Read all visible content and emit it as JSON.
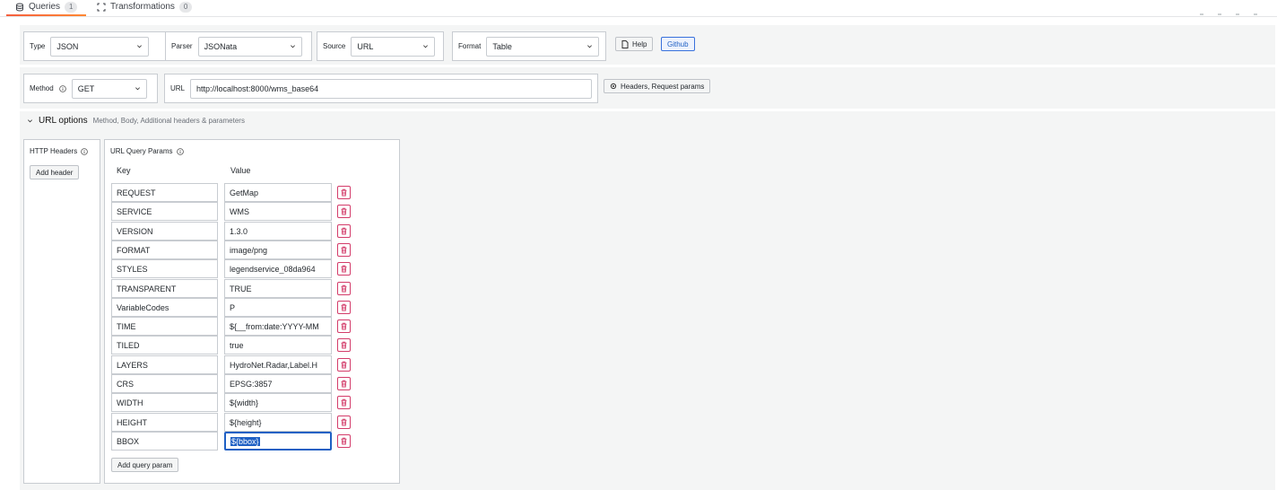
{
  "tabs": [
    {
      "label": "Queries",
      "count": "1",
      "icon": "database-icon"
    },
    {
      "label": "Transformations",
      "count": "0",
      "icon": "transform-icon"
    }
  ],
  "controls": {
    "type": {
      "label": "Type",
      "value": "JSON"
    },
    "parser": {
      "label": "Parser",
      "value": "JSONata"
    },
    "source": {
      "label": "Source",
      "value": "URL"
    },
    "format": {
      "label": "Format",
      "value": "Table"
    },
    "help_label": "Help",
    "github_label": "Github"
  },
  "request": {
    "method_label": "Method",
    "method_value": "GET",
    "url_label": "URL",
    "url_value": "http://localhost:8000/wms_base64",
    "headers_button": "Headers, Request params"
  },
  "url_options": {
    "title": "URL options",
    "description": "Method, Body, Additional headers & parameters"
  },
  "http_headers": {
    "title": "HTTP Headers",
    "add_label": "Add header"
  },
  "query_params": {
    "title": "URL Query Params",
    "key_header": "Key",
    "value_header": "Value",
    "add_label": "Add query param",
    "rows": [
      {
        "key": "REQUEST",
        "value": "GetMap"
      },
      {
        "key": "SERVICE",
        "value": "WMS"
      },
      {
        "key": "VERSION",
        "value": "1.3.0"
      },
      {
        "key": "FORMAT",
        "value": "image/png"
      },
      {
        "key": "STYLES",
        "value": "legendservice_08da964"
      },
      {
        "key": "TRANSPARENT",
        "value": "TRUE"
      },
      {
        "key": "VariableCodes",
        "value": "P"
      },
      {
        "key": "TIME",
        "value": "${__from:date:YYYY-MM"
      },
      {
        "key": "TILED",
        "value": "true"
      },
      {
        "key": "LAYERS",
        "value": "HydroNet.Radar,Label.H"
      },
      {
        "key": "CRS",
        "value": "EPSG:3857"
      },
      {
        "key": "WIDTH",
        "value": "${width}"
      },
      {
        "key": "HEIGHT",
        "value": "${height}"
      },
      {
        "key": "BBOX",
        "value": "${bbox}"
      }
    ]
  },
  "colors": {
    "accent": "#1f60c4",
    "delete": "#d33c6a",
    "tab_underline": "#f55f3e"
  }
}
